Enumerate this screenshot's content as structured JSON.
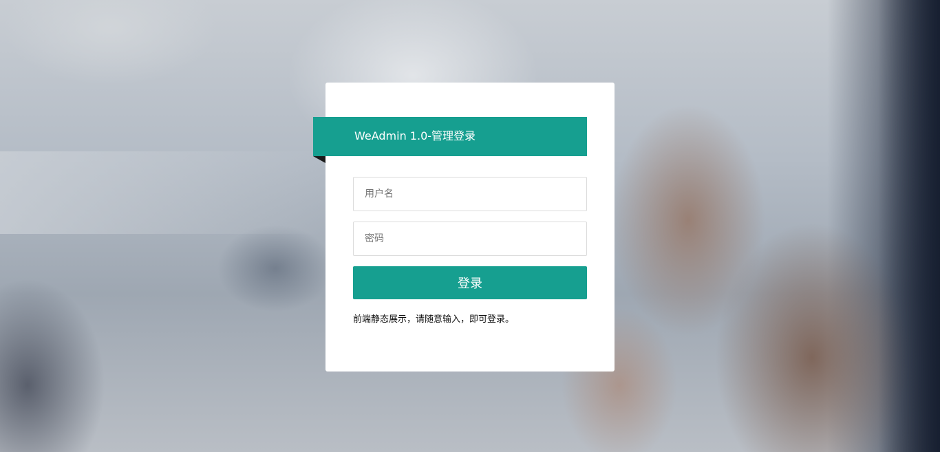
{
  "login": {
    "title": "WeAdmin 1.0-管理登录",
    "username_placeholder": "用户名",
    "password_placeholder": "密码",
    "username_value": "",
    "password_value": "",
    "submit_label": "登录",
    "hint_text": "前端静态展示，请随意输入，即可登录。"
  },
  "colors": {
    "accent": "#169f90",
    "card_background": "#ffffff",
    "ribbon_fold": "#1a1a1a"
  }
}
